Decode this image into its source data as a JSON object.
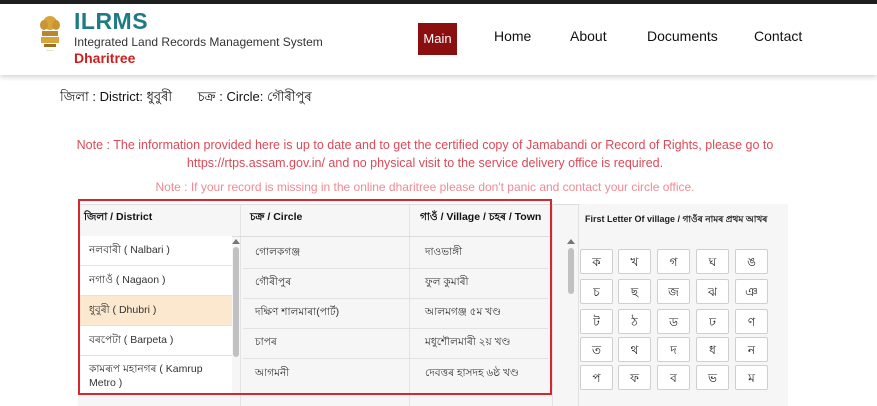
{
  "header": {
    "title": "ILRMS",
    "subtitle": "Integrated Land Records Management System",
    "name": "Dharitree"
  },
  "nav": {
    "main": "Main",
    "home": "Home",
    "about": "About",
    "documents": "Documents",
    "contact": "Contact"
  },
  "location": {
    "district": "জিলা : District: ধুবুৰী",
    "circle": "চক্ৰ : Circle: গৌৰীপুৰ"
  },
  "notes": {
    "note1": "Note : The information provided here is up to date and to get the certified copy of Jamabandi or Record of Rights, please go to https://rtps.assam.gov.in/ and no physical visit to the service delivery office is required.",
    "note2": "Note : If your record is missing in the online dharitree please don't panic and contact your circle office."
  },
  "table": {
    "district_header": "জিলা / District",
    "circle_header": "চক্ৰ / Circle",
    "village_header": "গাওঁ / Village / চহৰ / Town",
    "districts": [
      "নলবাৰী ( Nalbari )",
      "নগাওঁ ( Nagaon )",
      "ধুবুৰী ( Dhubri )",
      "বৰপেটা ( Barpeta )",
      "কামৰূপ মহানগৰ ( Kamrup Metro )"
    ],
    "active_district": "ধুবুৰী ( Dhubri )",
    "circles": [
      "গোলকগঞ্জ",
      "গৌৰীপুৰ",
      "দক্ষিণ শালমাৰা(পাৰ্ট)",
      "চাপৰ",
      "আগমনী"
    ],
    "villages": [
      "দাওভাঙ্গী",
      "ফুল কুমাৰী",
      "আলমগঞ্জ ৫ম খণ্ড",
      "মধুশৌলমাৰী ২য় খণ্ড",
      "দেবত্তৰ হাসদহ ৬ষ্ঠ খণ্ড"
    ]
  },
  "letters": {
    "header": "First Letter Of village / গাওঁৰ নামৰ প্ৰথম আখৰ",
    "keys": [
      "ক",
      "খ",
      "গ",
      "ঘ",
      "ঙ",
      "চ",
      "ছ",
      "জ",
      "ঝ",
      "ঞ",
      "ট",
      "ঠ",
      "ড",
      "ঢ",
      "ণ",
      "ত",
      "থ",
      "দ",
      "ধ",
      "ন",
      "প",
      "ফ",
      "ব",
      "ভ",
      "ম"
    ]
  }
}
